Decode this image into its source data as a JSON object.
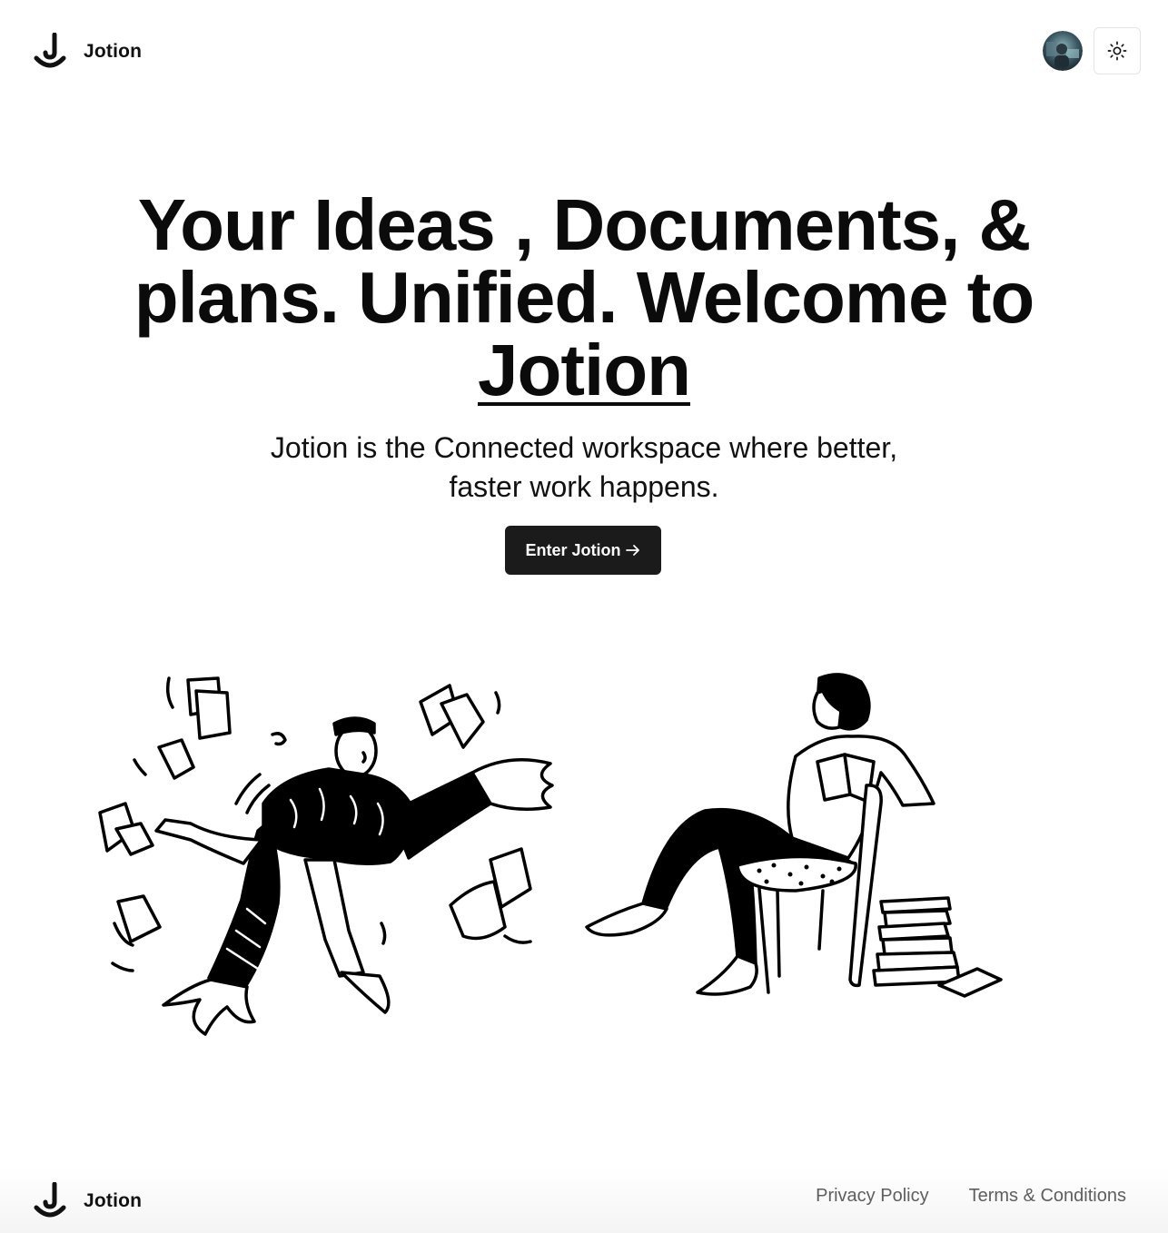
{
  "header": {
    "brand_name": "Jotion",
    "theme_toggle_icon": "sun-icon",
    "avatar_icon": "user-avatar"
  },
  "hero": {
    "heading_part1": "Your Ideas , Documents, & plans. Unified. Welcome to ",
    "heading_brand": "Jotion",
    "subheading": "Jotion is the Connected workspace where better, faster work happens.",
    "cta_label": "Enter Jotion",
    "cta_icon": "arrow-right-icon"
  },
  "illustrations": {
    "left": "person-throwing-papers-illustration",
    "right": "person-reading-on-chair-illustration"
  },
  "footer": {
    "brand_name": "Jotion",
    "links": [
      "Privacy Policy",
      "Terms & Conditions"
    ]
  },
  "colors": {
    "text": "#111111",
    "button_bg": "#1b1b1b",
    "button_text": "#ffffff",
    "footer_link": "#5e5e5e",
    "border": "#e4e4e4"
  }
}
